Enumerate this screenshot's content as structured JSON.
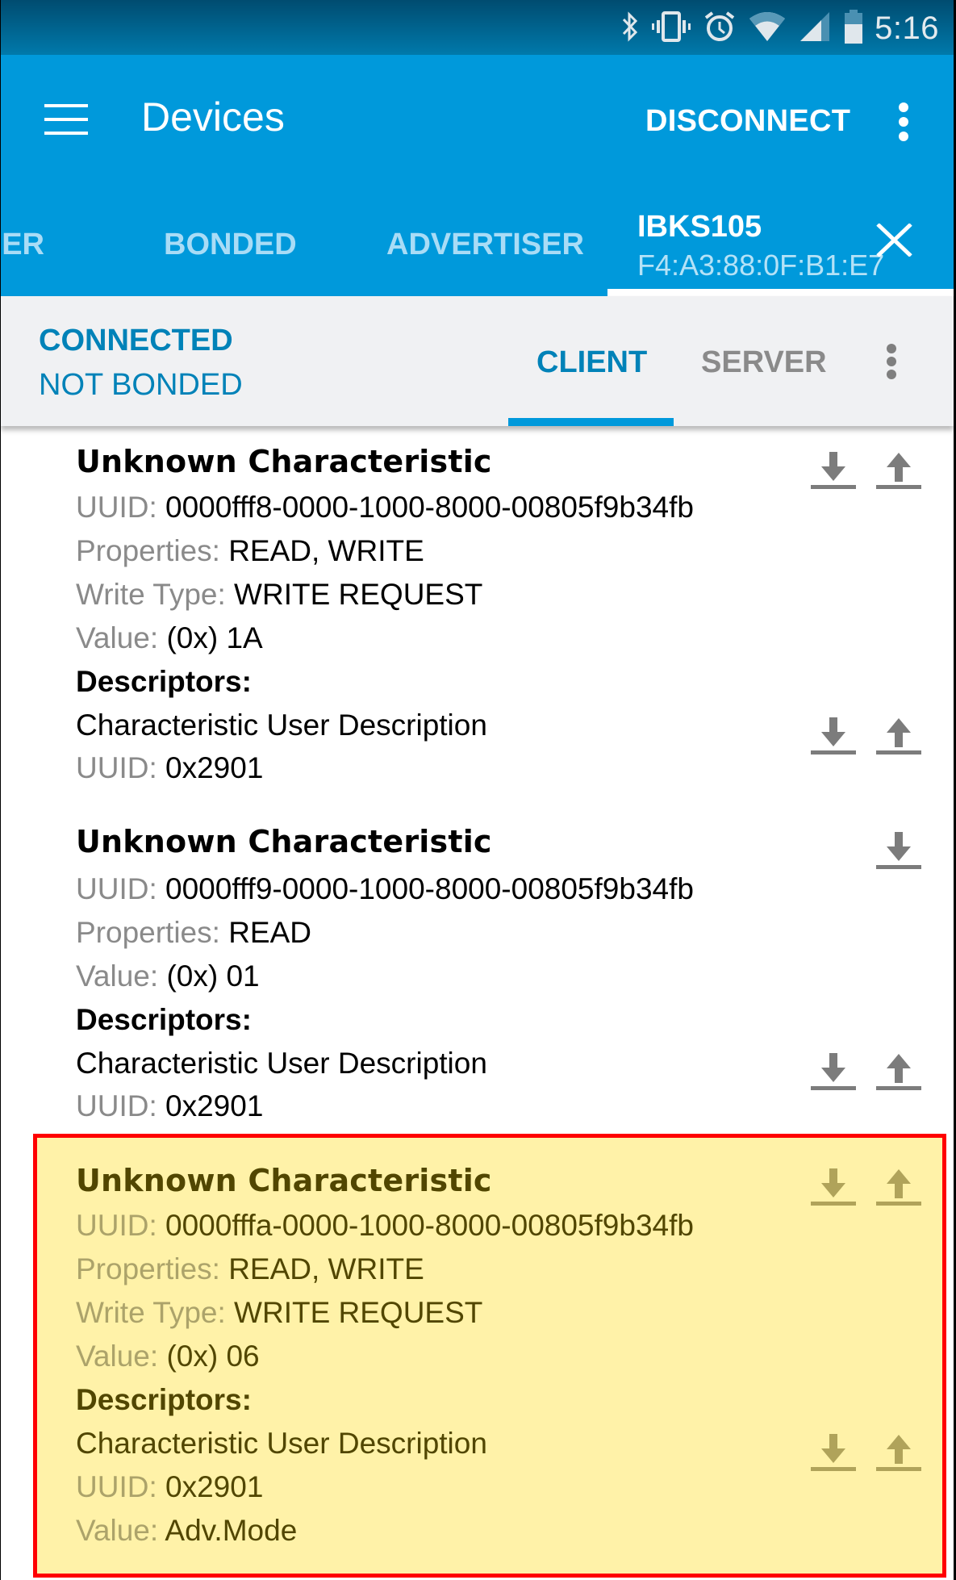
{
  "status_bar": {
    "time": "5:16",
    "icons": [
      "bluetooth-icon",
      "vibrate-icon",
      "alarm-icon",
      "wifi-icon",
      "cellular-signal-icon",
      "battery-icon"
    ]
  },
  "app_bar": {
    "title": "Devices",
    "menu_icon": "hamburger-menu-icon",
    "action_label": "DISCONNECT",
    "overflow_icon": "more-vert-icon"
  },
  "tabs": [
    {
      "label": "SCANNER",
      "active": false
    },
    {
      "label": "BONDED",
      "active": false
    },
    {
      "label": "ADVERTISER",
      "active": false
    },
    {
      "label": "IBKS105",
      "sublabel": "F4:A3:88:0F:B1:E7",
      "active": true,
      "close_icon": "close-icon"
    }
  ],
  "connection": {
    "state": "CONNECTED",
    "bond_state": "NOT BONDED",
    "subtabs": [
      {
        "label": "CLIENT",
        "active": true
      },
      {
        "label": "SERVER",
        "active": false
      }
    ],
    "overflow_icon": "more-vert-icon"
  },
  "colors": {
    "primary": "#0099db",
    "accent_text": "#0082b8",
    "highlight_fill": "#fff2a8",
    "highlight_border": "#ff0000"
  },
  "characteristics": [
    {
      "name": "Unknown Characteristic",
      "uuid_label": "UUID:",
      "uuid": "0000fff8-0000-1000-8000-00805f9b34fb",
      "properties_label": "Properties:",
      "properties": "READ, WRITE",
      "write_type_label": "Write Type:",
      "write_type": "WRITE REQUEST",
      "value_label": "Value:",
      "value": "(0x) 1A",
      "descriptors_label": "Descriptors:",
      "descriptor": {
        "name": "Characteristic User Description",
        "uuid_label": "UUID:",
        "uuid": "0x2901"
      },
      "actions": [
        "read",
        "write"
      ],
      "highlighted": false
    },
    {
      "name": "Unknown Characteristic",
      "uuid_label": "UUID:",
      "uuid": "0000fff9-0000-1000-8000-00805f9b34fb",
      "properties_label": "Properties:",
      "properties": "READ",
      "value_label": "Value:",
      "value": "(0x) 01",
      "descriptors_label": "Descriptors:",
      "descriptor": {
        "name": "Characteristic User Description",
        "uuid_label": "UUID:",
        "uuid": "0x2901"
      },
      "actions": [
        "read"
      ],
      "highlighted": false
    },
    {
      "name": "Unknown Characteristic",
      "uuid_label": "UUID:",
      "uuid": "0000fffa-0000-1000-8000-00805f9b34fb",
      "properties_label": "Properties:",
      "properties": "READ, WRITE",
      "write_type_label": "Write Type:",
      "write_type": "WRITE REQUEST",
      "value_label": "Value:",
      "value": "(0x) 06",
      "descriptors_label": "Descriptors:",
      "descriptor": {
        "name": "Characteristic User Description",
        "uuid_label": "UUID:",
        "uuid": "0x2901",
        "value_label": "Value:",
        "value": "Adv.Mode"
      },
      "actions": [
        "read",
        "write"
      ],
      "highlighted": true
    }
  ]
}
